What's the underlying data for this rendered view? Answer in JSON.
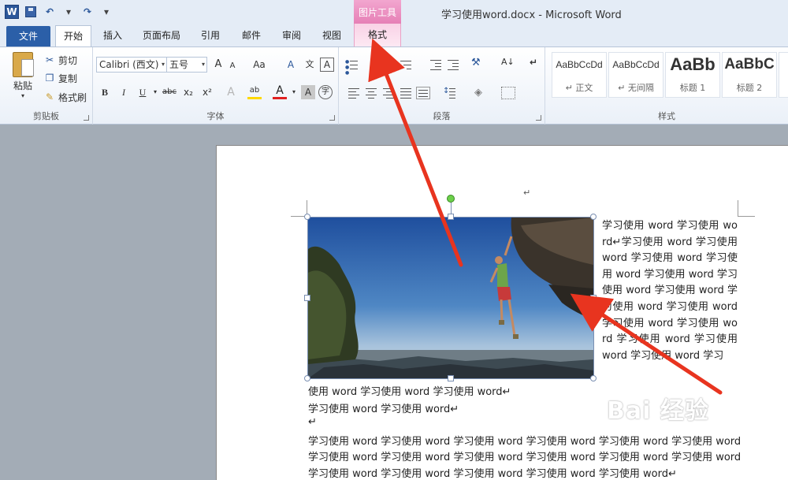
{
  "window": {
    "title": "学习使用word.docx - Microsoft Word"
  },
  "qat": {
    "logo": "W",
    "undo": "↶",
    "redo": "↷",
    "customize": "▾"
  },
  "context_tab": {
    "group_label": "图片工具",
    "tab_label": "格式"
  },
  "tabs": [
    {
      "label": "文件"
    },
    {
      "label": "开始"
    },
    {
      "label": "插入"
    },
    {
      "label": "页面布局"
    },
    {
      "label": "引用"
    },
    {
      "label": "邮件"
    },
    {
      "label": "审阅"
    },
    {
      "label": "视图"
    }
  ],
  "ribbon": {
    "clipboard": {
      "paste": "粘贴",
      "cut": "剪切",
      "copy": "复制",
      "format_painter": "格式刷",
      "label": "剪贴板"
    },
    "font": {
      "font_name": "Calibri (西文)",
      "font_size": "五号",
      "label": "字体",
      "grow": "A",
      "shrink": "A",
      "change_case": "Aa",
      "clear_format": "A",
      "bold": "B",
      "italic": "I",
      "underline": "U",
      "strike": "abc",
      "subscript": "x₂",
      "superscript": "x²",
      "text_effect": "A",
      "highlight": "ab",
      "font_color": "A",
      "char_shading": "A",
      "enclose": "字"
    },
    "paragraph": {
      "label": "段落"
    },
    "styles": {
      "label": "样式",
      "items": [
        {
          "sample": "AaBbCcDd",
          "name": "↵ 正文"
        },
        {
          "sample": "AaBbCcDd",
          "name": "↵ 无间隔"
        },
        {
          "sample": "AaBb",
          "name": "标题 1"
        },
        {
          "sample": "AaBbC",
          "name": "标题 2"
        }
      ]
    }
  },
  "document": {
    "para_mark": "↵",
    "wrap_text": "学习使用 word 学习使用 word↵学习使用 word 学习使用 word 学习使用 word 学习使用 word 学习使用 word 学习使用 word 学习使用 word 学习使用 word 学习使用 word 学习使用 word 学习使用 word 学习使用 word 学习使用 word 学习使用 word 学习",
    "line1": "使用 word 学习使用 word 学习使用 word↵",
    "line2": "学习使用 word 学习使用 word↵",
    "line3": "↵",
    "line4": "学习使用 word 学习使用 word 学习使用 word 学习使用 word 学习使用 word 学习使用 word",
    "line5": "学习使用 word 学习使用 word 学习使用 word 学习使用 word 学习使用 word 学习使用 word",
    "line6": "学习使用 word 学习使用 word 学习使用 word 学习使用 word 学习使用 word↵"
  },
  "watermark": {
    "text": "Bai 经验"
  },
  "colors": {
    "accent": "#2b579a",
    "context_pink": "#e680b6",
    "arrow": "#e8341f"
  }
}
